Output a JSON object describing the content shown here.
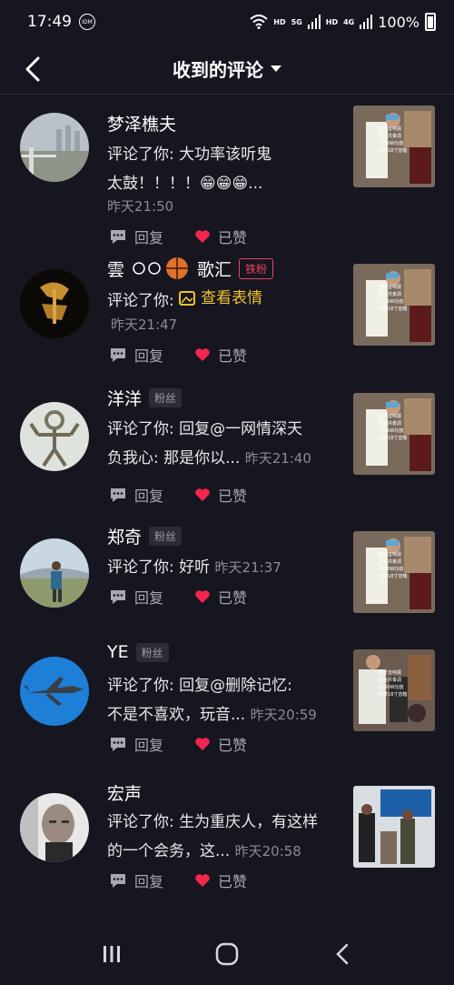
{
  "status": {
    "time": "17:49",
    "idm": "IDM",
    "hd1": "HD",
    "net1": "5G",
    "hd2": "HD",
    "net2": "4G",
    "battery": "100%"
  },
  "header": {
    "title": "收到的评论"
  },
  "labels": {
    "reply": "回复",
    "liked": "已赞"
  },
  "comments": [
    {
      "name": "梦泽樵夫",
      "badge": "",
      "line1": "评论了你: 大功率该听鬼",
      "line2": "太鼓！！！！😁😁😁...",
      "time": "昨天21:50"
    },
    {
      "name": "雲",
      "name_tail": "歌汇",
      "badge": "铁粉",
      "prefix": "评论了你: ",
      "link": "查看表情",
      "time": "昨天21:47"
    },
    {
      "name": "洋洋",
      "badge": "粉丝",
      "line1": "评论了你: 回复@一网情深天",
      "line2": "负我心: 那是你以...",
      "time": "昨天21:40"
    },
    {
      "name": "郑奇",
      "badge": "粉丝",
      "line1": "评论了你: 好听",
      "time": "昨天21:37"
    },
    {
      "name": "YE",
      "badge": "粉丝",
      "line1": "评论了你: 回复@删除记忆:",
      "line2": "不是不喜欢，玩音...",
      "time": "昨天20:59"
    },
    {
      "name": "宏声",
      "badge": "",
      "line1": "评论了你: 生为重庆人，有这样",
      "line2": "的一个会务，这...",
      "time": "昨天20:58"
    }
  ],
  "thumb_text": [
    "重庆音响展",
    "再合共奏调",
    "1000W功放",
    "驾驶18寸音箱"
  ]
}
